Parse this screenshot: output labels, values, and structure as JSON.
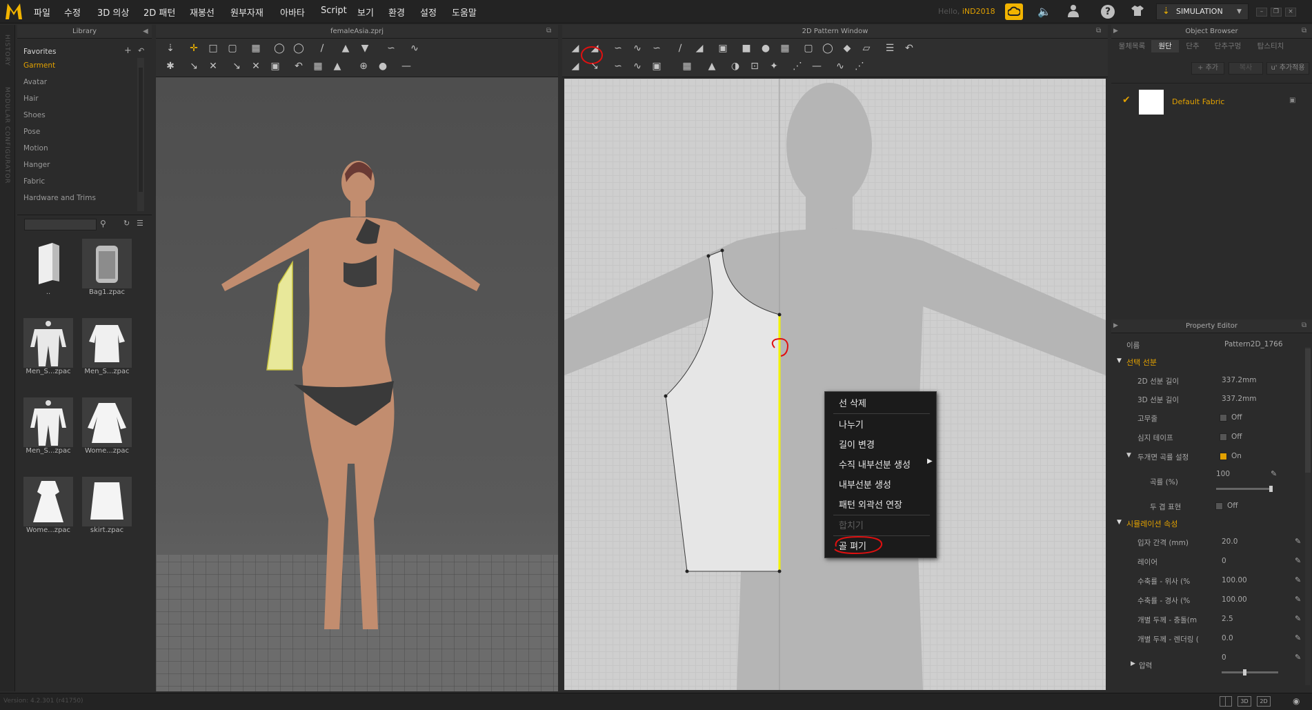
{
  "menubar": {
    "items": [
      "파일",
      "수정",
      "3D 의상",
      "2D 패턴",
      "재봉선",
      "원부자재",
      "아바타",
      "Script",
      "보기",
      "환경",
      "설정",
      "도움말"
    ],
    "hello_prefix": "Hello, ",
    "username": "iND2018",
    "simulation_label": "SIMULATION",
    "icons": [
      "cloud-icon",
      "speaker-icon",
      "user-icon",
      "help-icon",
      "garment-icon"
    ]
  },
  "sidebar": {
    "history_label": "HISTORY",
    "modular_label": "MODULAR CONFIGURATOR"
  },
  "library": {
    "title": "Library",
    "categories": [
      "Favorites",
      "Garment",
      "Avatar",
      "Hair",
      "Shoes",
      "Pose",
      "Motion",
      "Hanger",
      "Fabric",
      "Hardware and Trims"
    ],
    "selected_category": "Garment",
    "items": [
      {
        "label": "..",
        "icon": "folder-icon"
      },
      {
        "label": "Bag1.zpac",
        "icon": "bag-icon"
      },
      {
        "label": "Men_S...zpac",
        "icon": "suit-icon"
      },
      {
        "label": "Men_S...zpac",
        "icon": "shirt-icon"
      },
      {
        "label": "Men_S...zpac",
        "icon": "suit-icon"
      },
      {
        "label": "Wome...zpac",
        "icon": "coat-icon"
      },
      {
        "label": "Wome...zpac",
        "icon": "dress-icon"
      },
      {
        "label": "skirt.zpac",
        "icon": "skirt-icon"
      }
    ]
  },
  "view3d": {
    "title": "femaleAsia.zprj"
  },
  "view2d": {
    "title": "2D Pattern Window"
  },
  "context_menu": {
    "items": [
      {
        "label": "선 삭제",
        "enabled": true
      },
      {
        "label": "나누기",
        "enabled": true
      },
      {
        "label": "길이 변경",
        "enabled": true
      },
      {
        "label": "수직 내부선분 생성",
        "enabled": true,
        "submenu": true
      },
      {
        "label": "내부선분 생성",
        "enabled": true
      },
      {
        "label": "패턴 외곽선 연장",
        "enabled": true
      },
      {
        "label": "합치기",
        "enabled": false
      },
      {
        "label": "골 펴기",
        "enabled": true,
        "highlighted_with_circle": true
      }
    ]
  },
  "object_browser": {
    "title": "Object Browser",
    "tabs": [
      "물체목록",
      "원단",
      "단추",
      "단추구멍",
      "탑스티치"
    ],
    "active_tab": "원단",
    "add_label": "+ 추가",
    "copy_label": "복사",
    "add_to_label": "추가적용",
    "fabric_name": "Default Fabric"
  },
  "property_editor": {
    "title": "Property Editor",
    "name_label": "이름",
    "name_value": "Pattern2D_1766",
    "section1": "선택 선분",
    "rows1": [
      {
        "label": "2D 선분 길이",
        "value": "337.2mm"
      },
      {
        "label": "3D 선분 길이",
        "value": "337.2mm"
      },
      {
        "label": "고무줄",
        "value": "Off",
        "checkbox": false
      },
      {
        "label": "심지 테이프",
        "value": "Off",
        "checkbox": false
      },
      {
        "label": "두개면 곡률 설정",
        "value": "On",
        "checkbox": true
      },
      {
        "label": "곡률 (%)",
        "value": "100"
      },
      {
        "label": "두 겹 표현",
        "value": "Off",
        "checkbox": false
      }
    ],
    "section2": "시뮬레이션 속성",
    "rows2": [
      {
        "label": "입자 간격 (mm)",
        "value": "20.0"
      },
      {
        "label": "레이어",
        "value": "0"
      },
      {
        "label": "수축률 - 위사 (%",
        "value": "100.00"
      },
      {
        "label": "수축률 - 경사 (%",
        "value": "100.00"
      },
      {
        "label": "개별 두께 - 충돌(m",
        "value": "2.5"
      },
      {
        "label": "개별 두께 - 렌더링 (",
        "value": "0.0"
      },
      {
        "label": "압력",
        "value": "0"
      }
    ],
    "curvature_fraction": 1.0,
    "pressure_fraction": 0.4
  },
  "statusbar": {
    "version": "Version: 4.2.301 (r41750)",
    "view_buttons": [
      "",
      "3D",
      "2D",
      ""
    ]
  },
  "colors": {
    "accent": "#e2a100",
    "pattern_selected": "#e8e89a",
    "selected_edge": "#f2f200",
    "annotation_red": "#e01010"
  }
}
